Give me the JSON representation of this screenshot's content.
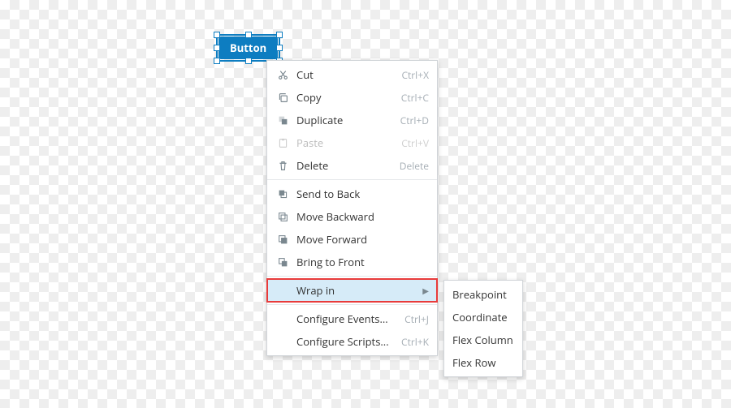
{
  "widget": {
    "label": "Button"
  },
  "context_menu": {
    "cut": {
      "label": "Cut",
      "shortcut": "Ctrl+X"
    },
    "copy": {
      "label": "Copy",
      "shortcut": "Ctrl+C"
    },
    "duplicate": {
      "label": "Duplicate",
      "shortcut": "Ctrl+D"
    },
    "paste": {
      "label": "Paste",
      "shortcut": "Ctrl+V"
    },
    "delete": {
      "label": "Delete",
      "shortcut": "Delete"
    },
    "send_back": {
      "label": "Send to Back"
    },
    "move_backward": {
      "label": "Move Backward"
    },
    "move_forward": {
      "label": "Move Forward"
    },
    "bring_front": {
      "label": "Bring to Front"
    },
    "wrap_in": {
      "label": "Wrap in"
    },
    "configure_events": {
      "label": "Configure Events...",
      "shortcut": "Ctrl+J"
    },
    "configure_scripts": {
      "label": "Configure Scripts...",
      "shortcut": "Ctrl+K"
    }
  },
  "wrap_submenu": {
    "breakpoint": {
      "label": "Breakpoint"
    },
    "coordinate": {
      "label": "Coordinate"
    },
    "flex_column": {
      "label": "Flex Column"
    },
    "flex_row": {
      "label": "Flex Row"
    }
  }
}
